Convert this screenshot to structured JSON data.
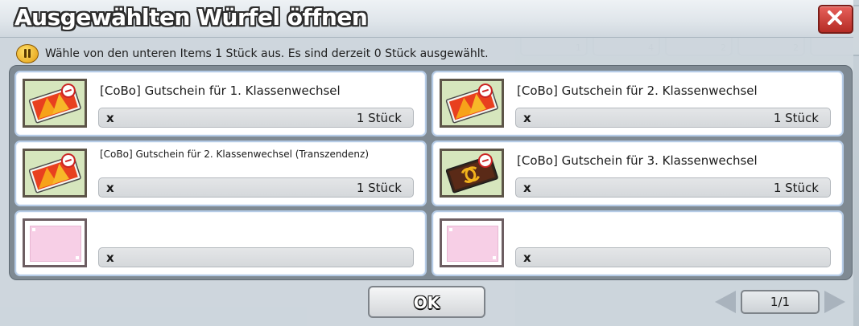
{
  "window": {
    "title": "Ausgewählten Würfel öffnen",
    "close_icon": "close-x-icon",
    "accent_color": "#c9372f"
  },
  "hint": {
    "icon": "pause-info-icon",
    "text": "Wähle von den unteren Items 1 Stück aus. Es sind derzeit 0 Stück ausgewählt."
  },
  "items": [
    {
      "name": "[CoBo] Gutschein für 1. Klassenwechsel",
      "qty_prefix": "x",
      "qty": "1 Stück",
      "icon": "voucher-ticket-icon"
    },
    {
      "name": "[CoBo] Gutschein für 2. Klassenwechsel",
      "qty_prefix": "x",
      "qty": "1 Stück",
      "icon": "voucher-ticket-icon"
    },
    {
      "name": "[CoBo] Gutschein für 2. Klassenwechsel (Transzendenz)",
      "qty_prefix": "x",
      "qty": "1 Stück",
      "icon": "voucher-ticket-icon"
    },
    {
      "name": "[CoBo] Gutschein für 3. Klassenwechsel",
      "qty_prefix": "x",
      "qty": "1 Stück",
      "icon": "dark-voucher-ticket-icon"
    },
    {
      "name": "",
      "qty_prefix": "x",
      "qty": "",
      "icon": "empty-slot-icon"
    },
    {
      "name": "",
      "qty_prefix": "x",
      "qty": "",
      "icon": "empty-slot-icon"
    }
  ],
  "footer": {
    "ok_label": "OK",
    "page_label": "1/1",
    "prev_icon": "arrow-left-icon",
    "next_icon": "arrow-right-icon"
  },
  "background": {
    "slot_counts": [
      "1",
      "4",
      "2",
      "2",
      "8"
    ]
  }
}
